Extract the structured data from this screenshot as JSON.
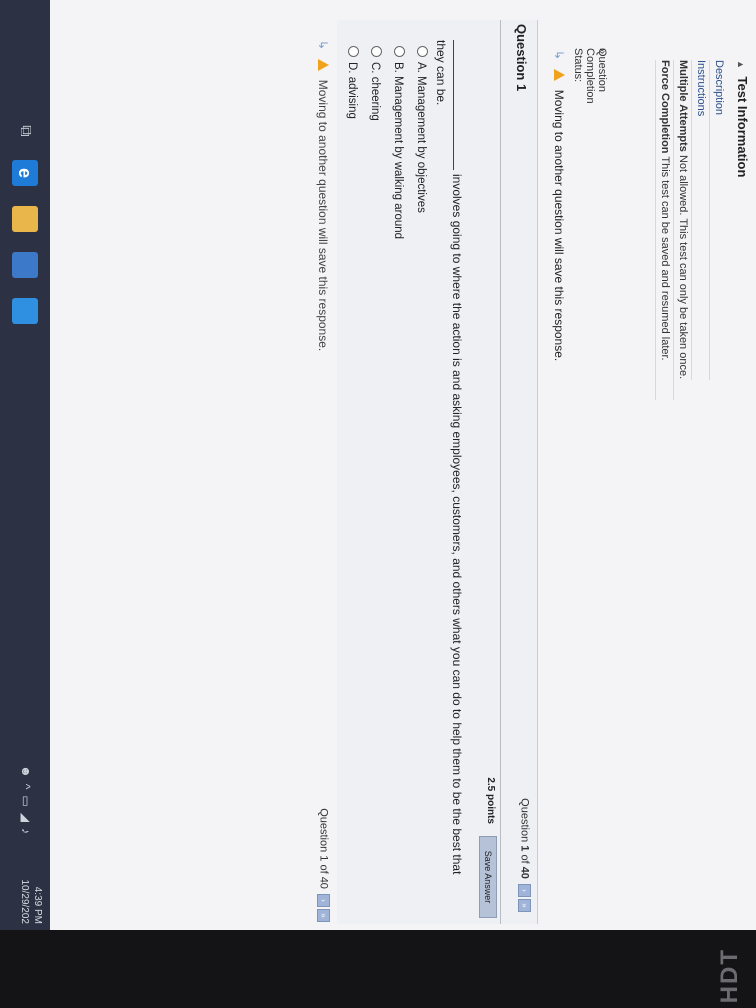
{
  "test_info": {
    "header": "Test Information",
    "description_label": "Description",
    "instructions_label": "Instructions",
    "multiple_attempts_label": "Multiple Attempts",
    "multiple_attempts_text": "Not allowed. This test can only be taken once.",
    "force_completion_label": "Force Completion",
    "force_completion_text": "This test can be saved and resumed later."
  },
  "completion_status": "Question Completion Status:",
  "warning_text": "Moving to another question will save this response.",
  "question": {
    "title": "Question 1",
    "nav_prefix": "Question",
    "nav_current": "1",
    "nav_of": "of",
    "nav_total": "40",
    "points": "2.5 points",
    "save_label": "Save Answer",
    "text": "involves going to where the action is and asking employees, customers, and others what you can do to help them to be the best that they can be.",
    "options": [
      "A. Management by objectives",
      "B. Management by walking around",
      "C. cheering",
      "D. advising"
    ]
  },
  "bottom_nav": "Question 1 of 40",
  "taskbar": {
    "time": "4:39 PM",
    "date": "10/29/202"
  },
  "bezel_brand": "HDT",
  "colors": {
    "warning": "#f1a21d",
    "nav_button": "#9fb4d8",
    "taskbar": "#2c3244"
  },
  "icons": [
    "chevron-icon",
    "arrow-icon",
    "warning-icon",
    "radio-icon",
    "next-icon",
    "last-icon",
    "edge-icon",
    "folder-icon",
    "store-icon",
    "mail-icon",
    "network-icon",
    "volume-icon"
  ]
}
